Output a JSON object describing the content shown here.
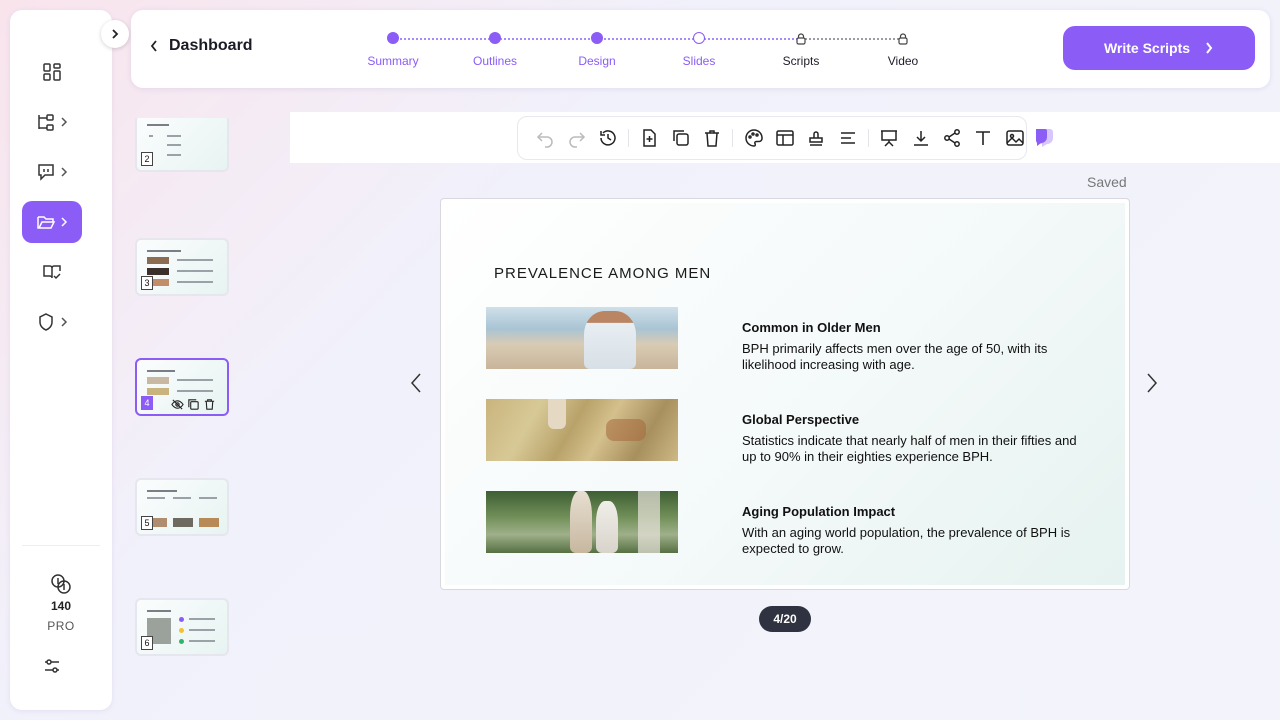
{
  "header": {
    "back_label": "Dashboard",
    "steps": [
      {
        "label": "Summary",
        "state": "done"
      },
      {
        "label": "Outlines",
        "state": "done"
      },
      {
        "label": "Design",
        "state": "done"
      },
      {
        "label": "Slides",
        "state": "current"
      },
      {
        "label": "Scripts",
        "state": "locked"
      },
      {
        "label": "Video",
        "state": "locked"
      }
    ],
    "write_button": "Write Scripts"
  },
  "sidebar": {
    "items": [
      {
        "icon": "dashboard-grid-icon"
      },
      {
        "icon": "tree-structure-icon"
      },
      {
        "icon": "chat-bubble-icon"
      },
      {
        "icon": "folder-open-icon",
        "active": true
      },
      {
        "icon": "book-check-icon"
      },
      {
        "icon": "shield-icon"
      }
    ],
    "credits": "140",
    "plan": "PRO"
  },
  "thumbnails": [
    {
      "number": "2"
    },
    {
      "number": "3"
    },
    {
      "number": "4",
      "active": true
    },
    {
      "number": "5"
    },
    {
      "number": "6"
    }
  ],
  "editor": {
    "status": "Saved",
    "page_indicator": "4/20",
    "accent": "#8b5cf6"
  },
  "slide": {
    "title": "PREVALENCE AMONG MEN",
    "items": [
      {
        "heading": "Common in Older Men",
        "text": "BPH primarily affects men over the age of 50, with its likelihood increasing with age."
      },
      {
        "heading": "Global Perspective",
        "text": "Statistics indicate that nearly half of men in their fifties and up to 90% in their eighties experience BPH."
      },
      {
        "heading": "Aging Population Impact",
        "text": "With an aging world population, the prevalence of BPH is expected to grow."
      }
    ]
  }
}
